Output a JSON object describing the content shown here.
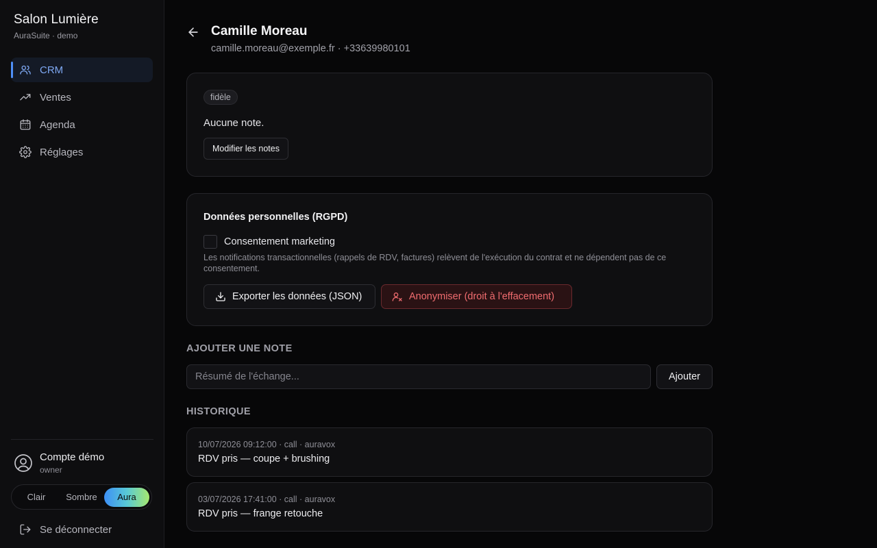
{
  "sidebar": {
    "brand_title": "Salon Lumière",
    "brand_subtitle": "AuraSuite · demo",
    "nav": [
      {
        "label": "CRM",
        "icon": "users-icon",
        "active": true
      },
      {
        "label": "Ventes",
        "icon": "trending-up-icon",
        "active": false
      },
      {
        "label": "Agenda",
        "icon": "calendar-icon",
        "active": false
      },
      {
        "label": "Réglages",
        "icon": "gear-icon",
        "active": false
      }
    ],
    "account": {
      "name": "Compte démo",
      "role": "owner",
      "icon": "user-circle-icon"
    },
    "theme": {
      "options": [
        "Clair",
        "Sombre",
        "Aura"
      ],
      "selected": "Aura"
    },
    "logout_label": "Se déconnecter"
  },
  "client": {
    "name": "Camille Moreau",
    "contact": "camille.moreau@exemple.fr · +33639980101"
  },
  "notes_card": {
    "tag": "fidèle",
    "notes_text": "Aucune note.",
    "edit_button": "Modifier les notes"
  },
  "rgpd": {
    "title": "Données personnelles (RGPD)",
    "consent_label": "Consentement marketing",
    "consent_checked": false,
    "consent_help": "Les notifications transactionnelles (rappels de RDV, factures) relèvent de l'exécution du contrat et ne dépendent pas de ce consentement.",
    "export_button": "Exporter les données (JSON)",
    "anonymize_button": "Anonymiser (droit à l'effacement)"
  },
  "add_note": {
    "section_label": "AJOUTER UNE NOTE",
    "placeholder": "Résumé de l'échange...",
    "value": "",
    "button": "Ajouter"
  },
  "history": {
    "section_label": "HISTORIQUE",
    "items": [
      {
        "meta": "10/07/2026 09:12:00 · call · auravox",
        "text": "RDV pris — coupe + brushing"
      },
      {
        "meta": "03/07/2026 17:41:00 · call · auravox",
        "text": "RDV pris — frange retouche"
      }
    ]
  },
  "colors": {
    "accent": "#4f8ff7",
    "danger": "#f06c6f",
    "background": "#070708",
    "card": "#0f0f11"
  }
}
